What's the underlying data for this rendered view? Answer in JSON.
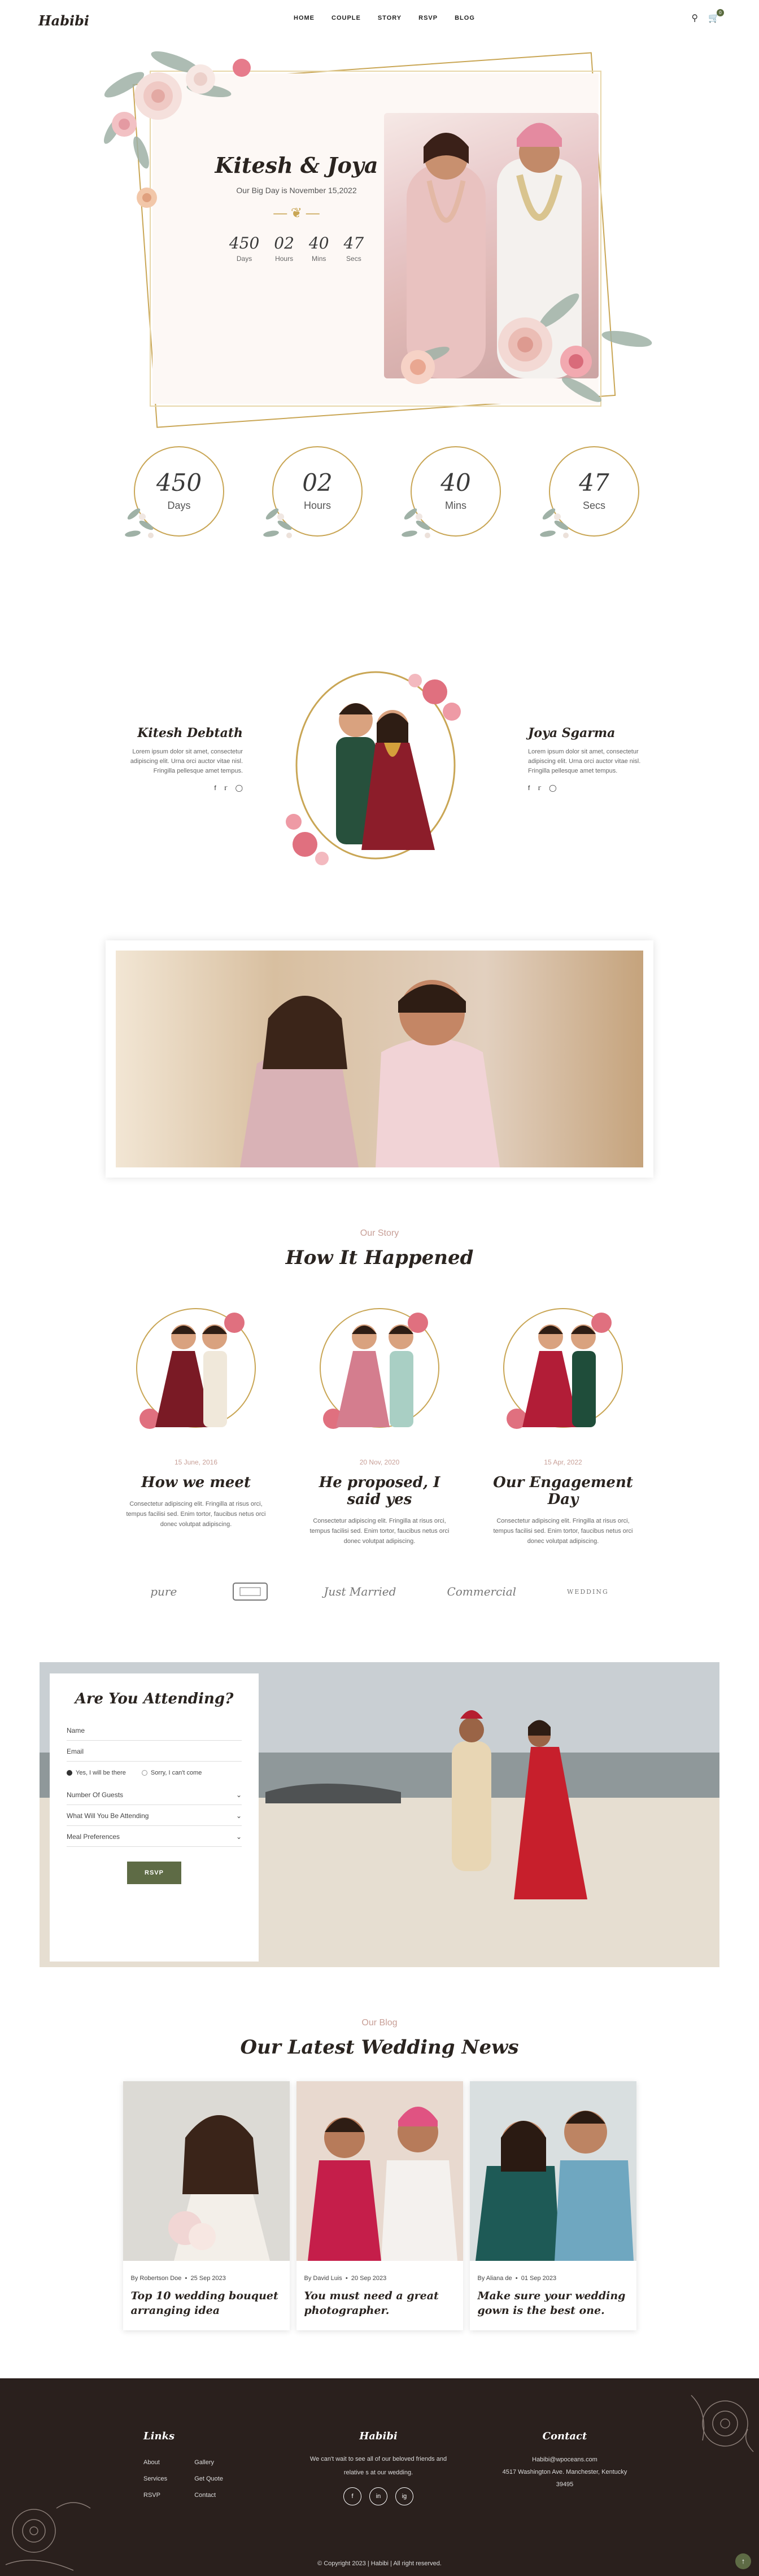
{
  "brand": {
    "logo": "Habibi"
  },
  "nav": {
    "items": [
      "HOME",
      "COUPLE",
      "STORY",
      "RSVP",
      "BLOG"
    ],
    "cart_count": "0"
  },
  "hero": {
    "title": "Kitesh & Joya",
    "subtitle": "Our Big Day is November 15,2022",
    "countdown": [
      {
        "value": "450",
        "label": "Days"
      },
      {
        "value": "02",
        "label": "Hours"
      },
      {
        "value": "40",
        "label": "Mins"
      },
      {
        "value": "47",
        "label": "Secs"
      }
    ]
  },
  "countdown": [
    {
      "value": "450",
      "label": "Days"
    },
    {
      "value": "02",
      "label": "Hours"
    },
    {
      "value": "40",
      "label": "Mins"
    },
    {
      "value": "47",
      "label": "Secs"
    }
  ],
  "couple": {
    "groom": {
      "name": "Kitesh Debtath",
      "bio": "Lorem ipsum dolor sit amet, consectetur adipiscing elit. Urna orci auctor vitae nisl. Fringilla pellesque amet tempus."
    },
    "bride": {
      "name": "Joya Sgarma",
      "bio": "Lorem ipsum dolor sit amet, consectetur adipiscing elit. Urna orci auctor vitae nisl. Fringilla pellesque amet tempus."
    }
  },
  "story": {
    "subtitle": "Our Story",
    "title": "How It Happened",
    "items": [
      {
        "date": "15 June, 2016",
        "title": "How we meet",
        "text": "Consectetur adipiscing elit. Fringilla at risus orci, tempus facilisi sed. Enim tortor, faucibus netus orci donec volutpat adipiscing."
      },
      {
        "date": "20 Nov, 2020",
        "title": "He proposed, I said yes",
        "text": "Consectetur adipiscing elit. Fringilla at risus orci, tempus facilisi sed. Enim tortor, faucibus netus orci donec volutpat adipiscing."
      },
      {
        "date": "15 Apr, 2022",
        "title": "Our Engagement Day",
        "text": "Consectetur adipiscing elit. Fringilla at risus orci, tempus facilisi sed. Enim tortor, faucibus netus orci donec volutpat adipiscing."
      }
    ]
  },
  "partners": [
    "pure",
    "",
    "Just Married",
    "Commercial",
    "WEDDING"
  ],
  "rsvp": {
    "title": "Are You Attending?",
    "name_label": "Name",
    "email_label": "Email",
    "radio_yes": "Yes, I will be there",
    "radio_no": "Sorry, I can't come",
    "guests_label": "Number Of Guests",
    "attending_label": "What Will You Be Attending",
    "meal_label": "Meal Preferences",
    "button": "RSVP"
  },
  "blog": {
    "subtitle": "Our Blog",
    "title": "Our Latest Wedding News",
    "posts": [
      {
        "author": "By Robertson Doe",
        "date": "25 Sep 2023",
        "title": "Top 10 wedding bouquet arranging idea"
      },
      {
        "author": "By David Luis",
        "date": "20 Sep 2023",
        "title": "You must need a great photographer."
      },
      {
        "author": "By Aliana de",
        "date": "01 Sep 2023",
        "title": "Make sure your wedding gown is the best one."
      }
    ]
  },
  "footer": {
    "links_title": "Links",
    "links_col1": [
      "About",
      "Services",
      "RSVP"
    ],
    "links_col2": [
      "Gallery",
      "Get Quote",
      "Contact"
    ],
    "brand": "Habibi",
    "tagline": "We can't wait to see all of our beloved friends and relative s at our wedding.",
    "socials": [
      "f",
      "in",
      "ig"
    ],
    "contact_title": "Contact",
    "email": "Habibi@wpoceans.com",
    "address": "4517 Washington Ave. Manchester, Kentucky 39495",
    "copyright": "© Copyright 2023 | Habibi | All right reserved."
  },
  "colors": {
    "accent": "#5e6b45",
    "gold": "#c9a655",
    "rose": "#c89f97",
    "footer_bg": "#2a201d"
  }
}
